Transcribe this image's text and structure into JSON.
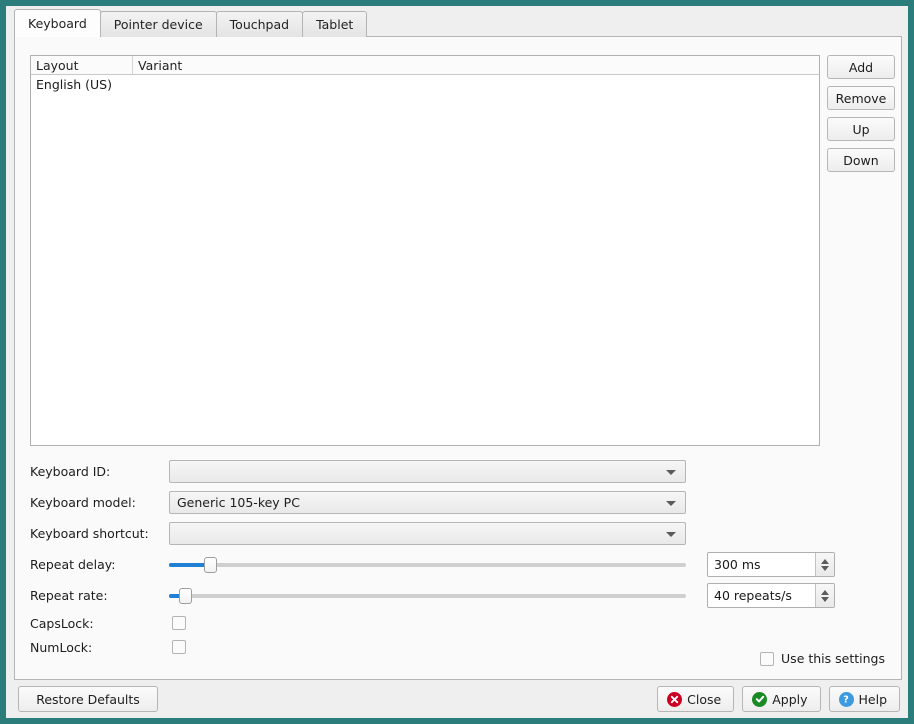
{
  "window": {
    "frame_color": "#2a7d7b",
    "pane_bg": "#fafafa"
  },
  "tabs": [
    {
      "label": "Keyboard",
      "selected": true
    },
    {
      "label": "Pointer device",
      "selected": false
    },
    {
      "label": "Touchpad",
      "selected": false
    },
    {
      "label": "Tablet",
      "selected": false
    }
  ],
  "layout_list": {
    "columns": [
      "Layout",
      "Variant"
    ],
    "rows": [
      {
        "layout": "English (US)",
        "variant": ""
      }
    ]
  },
  "side_buttons": [
    {
      "label": "Add",
      "name": "add-button"
    },
    {
      "label": "Remove",
      "name": "remove-button"
    },
    {
      "label": "Up",
      "name": "up-button"
    },
    {
      "label": "Down",
      "name": "down-button"
    }
  ],
  "form": {
    "keyboard_id": {
      "label": "Keyboard ID:",
      "value": ""
    },
    "keyboard_model": {
      "label": "Keyboard model:",
      "value": "Generic 105-key PC"
    },
    "keyboard_shortcut": {
      "label": "Keyboard shortcut:",
      "value": ""
    },
    "repeat_delay": {
      "label": "Repeat delay:",
      "value": "300 ms",
      "slider_percent": 7,
      "fill_color": "#1f80d4"
    },
    "repeat_rate": {
      "label": "Repeat rate:",
      "value": "40 repeats/s",
      "slider_percent": 2,
      "fill_color": "#1f80d4"
    },
    "capslock": {
      "label": "CapsLock:",
      "checked": false
    },
    "numlock": {
      "label": "NumLock:",
      "checked": false
    }
  },
  "use_this_settings": {
    "label": "Use this settings",
    "checked": false
  },
  "bottom_bar": {
    "restore_defaults": "Restore Defaults",
    "close": {
      "label": "Close",
      "icon": "close-circle-icon",
      "color": "#cc0022"
    },
    "apply": {
      "label": "Apply",
      "icon": "check-circle-icon",
      "color": "#1a8a24"
    },
    "help": {
      "label": "Help",
      "icon": "question-circle-icon",
      "color": "#3d9ae0"
    }
  }
}
